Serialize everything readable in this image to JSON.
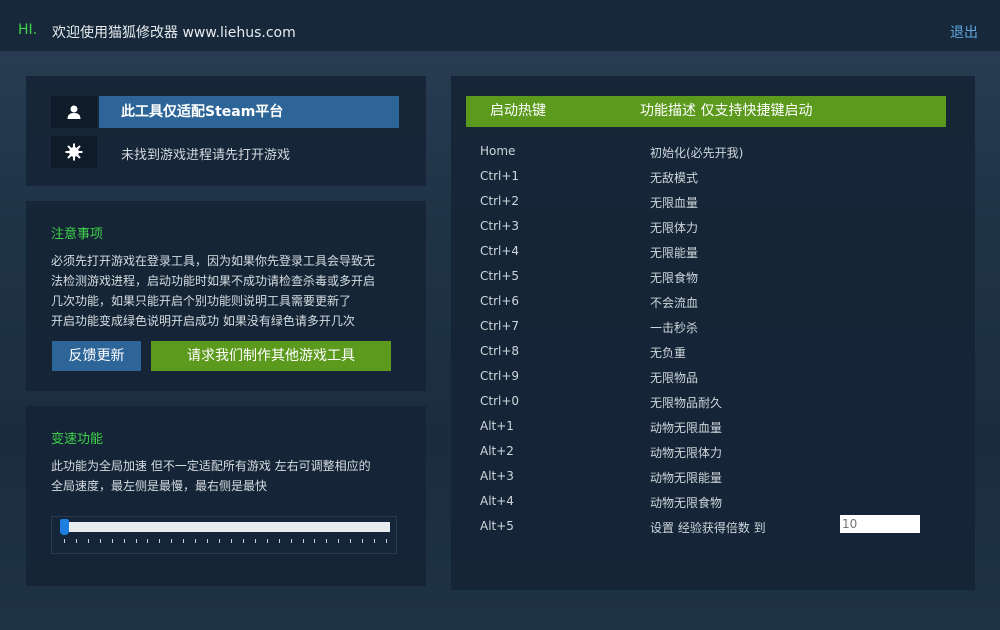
{
  "header": {
    "hi": "HI.",
    "title": "欢迎使用猫狐修改器 www.liehus.com",
    "exit_label": "退出"
  },
  "platform": {
    "banner": "此工具仅适配Steam平台",
    "status": "未找到游戏进程请先打开游戏"
  },
  "notice": {
    "heading": "注意事项",
    "lines": [
      "必须先打开游戏在登录工具，因为如果你先登录工具会导致无",
      "法检测游戏进程，启动功能时如果不成功请检查杀毒或多开启",
      "几次功能，如果只能开启个别功能则说明工具需要更新了",
      "开启功能变成绿色说明开启成功 如果没有绿色请多开几次"
    ],
    "feedback_label": "反馈更新",
    "request_label": "请求我们制作其他游戏工具"
  },
  "speed": {
    "heading": "变速功能",
    "lines": [
      "此功能为全局加速 但不一定适配所有游戏 左右可调整相应的",
      "全局速度，最左侧是最慢，最右侧是最快"
    ],
    "slider_value": 0
  },
  "hotkeys": {
    "col_key": "启动热键",
    "col_desc": "功能描述 仅支持快捷键启动",
    "rows": [
      {
        "key": "Home",
        "desc": "初始化(必先开我)"
      },
      {
        "key": "Ctrl+1",
        "desc": "无敌模式"
      },
      {
        "key": "Ctrl+2",
        "desc": "无限血量"
      },
      {
        "key": "Ctrl+3",
        "desc": "无限体力"
      },
      {
        "key": "Ctrl+4",
        "desc": "无限能量"
      },
      {
        "key": "Ctrl+5",
        "desc": "无限食物"
      },
      {
        "key": "Ctrl+6",
        "desc": "不会流血"
      },
      {
        "key": "Ctrl+7",
        "desc": "一击秒杀"
      },
      {
        "key": "Ctrl+8",
        "desc": "无负重"
      },
      {
        "key": "Ctrl+9",
        "desc": "无限物品"
      },
      {
        "key": "Ctrl+0",
        "desc": "无限物品耐久"
      },
      {
        "key": "Alt+1",
        "desc": "动物无限血量"
      },
      {
        "key": "Alt+2",
        "desc": "动物无限体力"
      },
      {
        "key": "Alt+3",
        "desc": "动物无限能量"
      },
      {
        "key": "Alt+4",
        "desc": "动物无限食物"
      },
      {
        "key": "Alt+5",
        "desc": "设置 经验获得倍数 到"
      }
    ],
    "exp_value": "10"
  },
  "colors": {
    "accent_green": "#5c9a1e",
    "accent_blue": "#2e6598",
    "heading_green": "#3fd24a",
    "link_blue": "#5ea8dd"
  },
  "icons": {
    "user": "user-icon",
    "gear": "gear-icon"
  }
}
